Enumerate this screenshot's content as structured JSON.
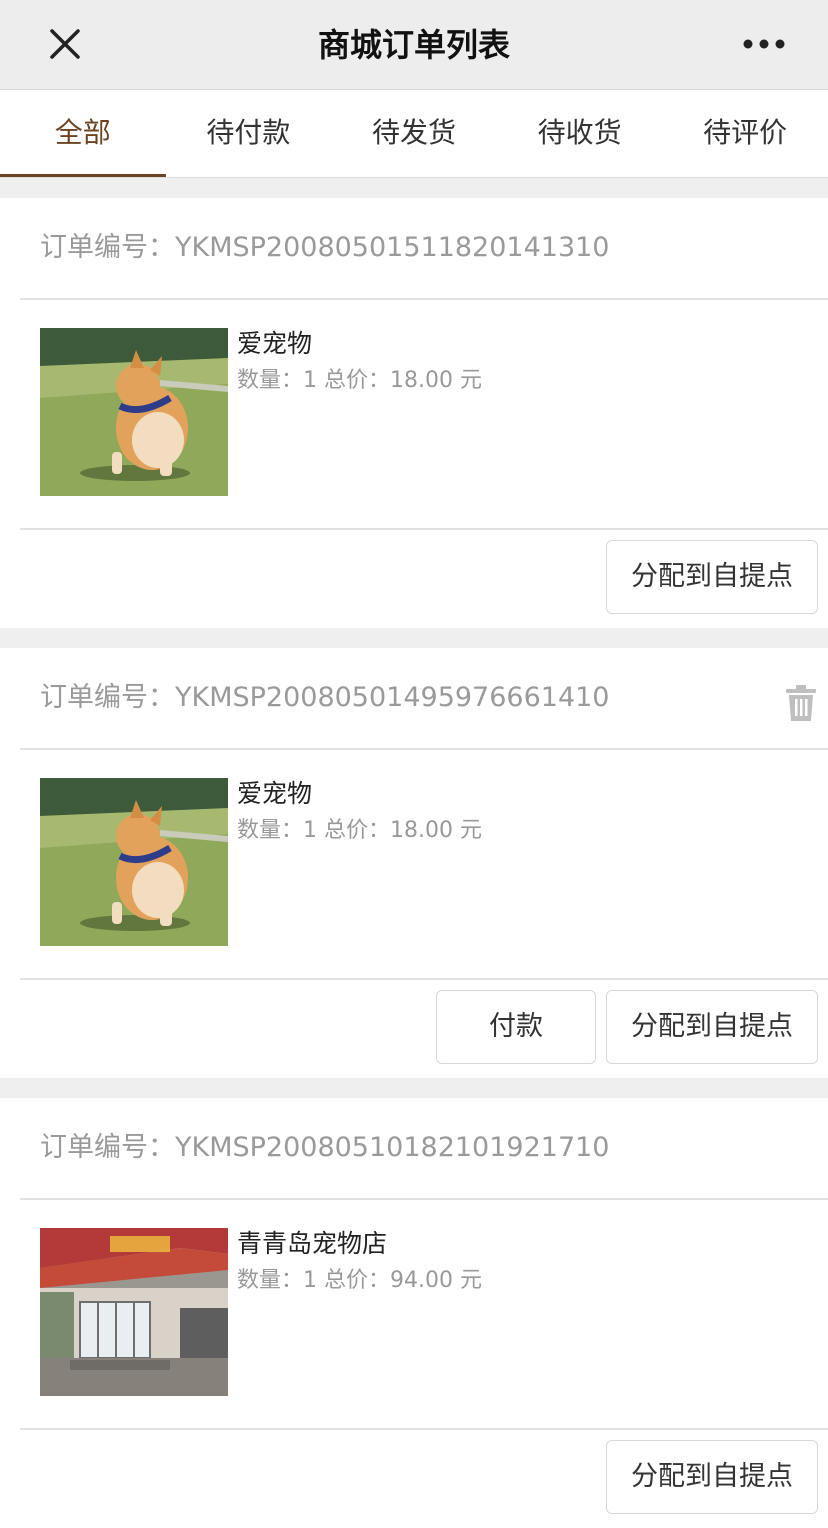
{
  "header": {
    "title": "商城订单列表",
    "close_icon": "close-icon",
    "more_icon": "more-icon"
  },
  "tabs": [
    {
      "label": "全部",
      "active": true
    },
    {
      "label": "待付款",
      "active": false
    },
    {
      "label": "待发货",
      "active": false
    },
    {
      "label": "待收货",
      "active": false
    },
    {
      "label": "待评价",
      "active": false
    }
  ],
  "accent_color": "#6b4423",
  "orders": [
    {
      "order_no": "订单编号：YKMSP20080501511820141310",
      "product_name": "爱宠物",
      "product_info": "数量：1  总价：18.00 元",
      "image": "corgi-photo",
      "delete_icon": false,
      "pay_label": "",
      "assign_label": "分配到自提点"
    },
    {
      "order_no": "订单编号：YKMSP20080501495976661410",
      "product_name": "爱宠物",
      "product_info": "数量：1  总价：18.00 元",
      "image": "corgi-photo",
      "delete_icon": true,
      "pay_label": "付款",
      "assign_label": "分配到自提点"
    },
    {
      "order_no": "订单编号：YKMSP20080510182101921710",
      "product_name": "青青岛宠物店",
      "product_info": "数量：1  总价：94.00 元",
      "image": "pet-store-photo",
      "delete_icon": false,
      "pay_label": "",
      "assign_label": "分配到自提点"
    }
  ]
}
